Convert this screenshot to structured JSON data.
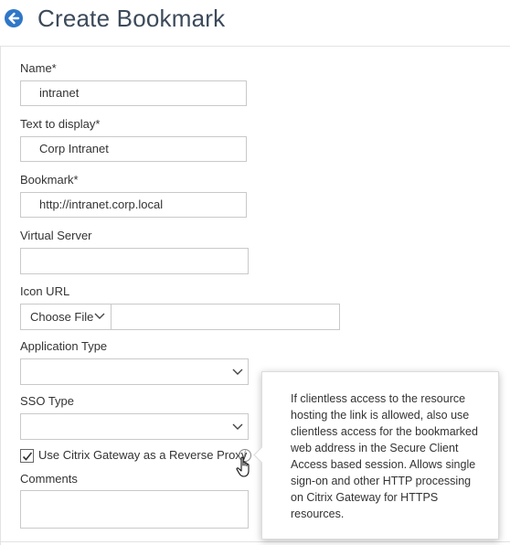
{
  "header": {
    "title": "Create Bookmark",
    "back_icon": "arrow-left-icon",
    "accent": "#2f77c7"
  },
  "form": {
    "name": {
      "label": "Name*",
      "value": "intranet"
    },
    "text_to_display": {
      "label": "Text to display*",
      "value": "Corp Intranet"
    },
    "bookmark": {
      "label": "Bookmark*",
      "value": "http://intranet.corp.local"
    },
    "virtual_server": {
      "label": "Virtual Server",
      "value": ""
    },
    "icon_url": {
      "label": "Icon URL",
      "choose_file_label": "Choose File",
      "value": ""
    },
    "application_type": {
      "label": "Application Type",
      "selected": ""
    },
    "sso_type": {
      "label": "SSO Type",
      "selected": ""
    },
    "reverse_proxy": {
      "label": "Use Citrix Gateway as a Reverse Proxy",
      "checked": true,
      "info_icon": "info-icon"
    },
    "comments": {
      "label": "Comments",
      "value": ""
    }
  },
  "tooltip": {
    "text": "If clientless access to the resource hosting the link is allowed, also use clientless access for the bookmarked web address in the Secure Client Access based session. Allows single sign-on and other HTTP processing on Citrix Gateway for HTTPS resources."
  }
}
